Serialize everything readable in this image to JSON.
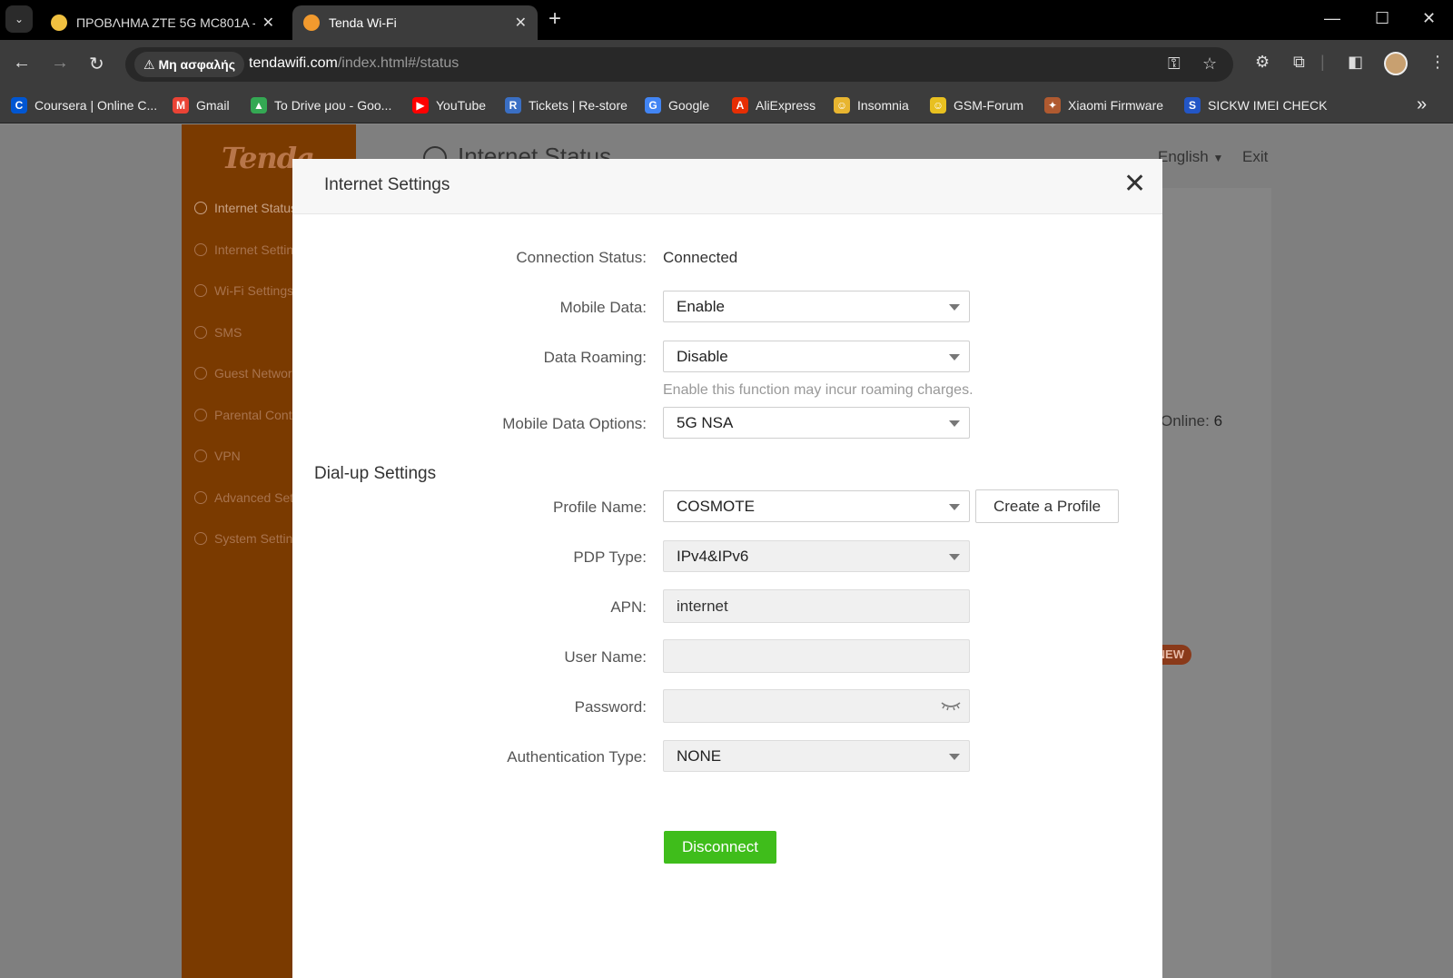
{
  "browser": {
    "tabs": [
      {
        "title": "ΠΡΟΒΛΗΜΑ ZTE 5G MC801A -",
        "favicon_color": "#f0c040",
        "active": false
      },
      {
        "title": "Tenda Wi-Fi",
        "favicon_color": "#f29a2e",
        "active": true
      }
    ],
    "security_label": "Μη ασφαλής",
    "url_host": "tendawifi.com",
    "url_path": "/index.html#/status",
    "bookmarks": [
      {
        "label": "Coursera | Online C...",
        "icon": "coursera-icon",
        "color": "#0056d2",
        "glyph": "C"
      },
      {
        "label": "Gmail",
        "icon": "gmail-icon",
        "color": "#ea4335",
        "glyph": "M"
      },
      {
        "label": "Το Drive μου - Goo...",
        "icon": "drive-icon",
        "color": "#34a853",
        "glyph": "▲"
      },
      {
        "label": "YouTube",
        "icon": "youtube-icon",
        "color": "#ff0000",
        "glyph": "▶"
      },
      {
        "label": "Tickets | Re-store",
        "icon": "restore-icon",
        "color": "#3a6fc4",
        "glyph": "R"
      },
      {
        "label": "Google",
        "icon": "google-icon",
        "color": "#4285f4",
        "glyph": "G"
      },
      {
        "label": "AliExpress",
        "icon": "aliexpress-icon",
        "color": "#e62e04",
        "glyph": "A"
      },
      {
        "label": "Insomnia",
        "icon": "insomnia-icon",
        "color": "#e8b530",
        "glyph": "☺"
      },
      {
        "label": "GSM-Forum",
        "icon": "gsm-forum-icon",
        "color": "#e8c020",
        "glyph": "☺"
      },
      {
        "label": "Xiaomi Firmware",
        "icon": "xiaomi-icon",
        "color": "#b05a30",
        "glyph": "✦"
      },
      {
        "label": "SICKW IMEI CHECK",
        "icon": "sickw-icon",
        "color": "#2356c6",
        "glyph": "S"
      }
    ]
  },
  "app": {
    "logo": "Tenda",
    "page_title": "Internet Status",
    "language": "English",
    "exit_label": "Exit",
    "online_label": "Online:",
    "online_count": "6",
    "new_badge": "NEW",
    "sidebar": [
      {
        "label": "Internet Status",
        "icon": "globe-icon",
        "active": true
      },
      {
        "label": "Internet Settings",
        "icon": "settings-icon",
        "active": false
      },
      {
        "label": "Wi-Fi Settings",
        "icon": "wifi-icon",
        "active": false
      },
      {
        "label": "SMS",
        "icon": "sms-icon",
        "active": false
      },
      {
        "label": "Guest Network",
        "icon": "guest-icon",
        "active": false
      },
      {
        "label": "Parental Control",
        "icon": "parental-icon",
        "active": false
      },
      {
        "label": "VPN",
        "icon": "vpn-icon",
        "active": false
      },
      {
        "label": "Advanced Settings",
        "icon": "advanced-icon",
        "active": false
      },
      {
        "label": "System Settings",
        "icon": "system-icon",
        "active": false
      }
    ]
  },
  "modal": {
    "title": "Internet Settings",
    "connection_status_label": "Connection Status:",
    "connection_status_value": "Connected",
    "mobile_data_label": "Mobile Data:",
    "mobile_data_value": "Enable",
    "data_roaming_label": "Data Roaming:",
    "data_roaming_value": "Disable",
    "roaming_hint": "Enable this function may incur roaming charges.",
    "mobile_data_options_label": "Mobile Data Options:",
    "mobile_data_options_value": "5G NSA",
    "dialup_title": "Dial-up Settings",
    "profile_name_label": "Profile Name:",
    "profile_name_value": "COSMOTE",
    "create_profile_label": "Create a Profile",
    "pdp_type_label": "PDP Type:",
    "pdp_type_value": "IPv4&IPv6",
    "apn_label": "APN:",
    "apn_value": "internet",
    "user_name_label": "User Name:",
    "user_name_value": "",
    "password_label": "Password:",
    "password_value": "",
    "auth_type_label": "Authentication Type:",
    "auth_type_value": "NONE",
    "disconnect_label": "Disconnect",
    "disconnect_color": "#3fbd1b"
  }
}
